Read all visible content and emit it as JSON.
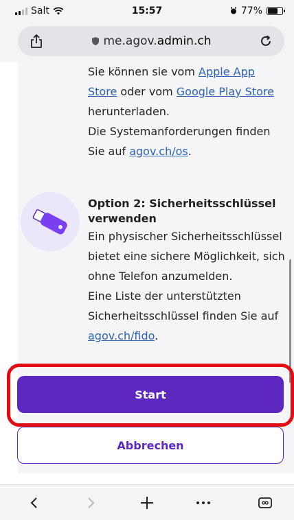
{
  "status": {
    "carrier": "Salt",
    "time": "15:57",
    "battery": "77%",
    "battery_level": 0.77
  },
  "browser": {
    "url_domain_prefix": "me.agov.",
    "url_domain_main": "admin.ch"
  },
  "content": {
    "block1": {
      "line1": "Sie können sie vom ",
      "link_apple": "Apple App Store",
      "line2": " oder vom ",
      "link_google": "Google Play Store",
      "line3": " herunterladen.",
      "line4": "Die Systemanforderungen finden Sie auf ",
      "link_os": "agov.ch/os",
      "line4_end": "."
    },
    "option2": {
      "title": "Option 2: Sicherheitsschlüssel verwenden",
      "text1": "Ein physischer Sicherheitsschlüssel bietet eine sichere Möglichkeit, sich ohne Telefon anzumelden.",
      "text2": "Eine Liste der unterstützten Sicherheitsschlüssel finden Sie auf ",
      "link_fido": "agov.ch/fido",
      "text2_end": "."
    }
  },
  "buttons": {
    "start": "Start",
    "cancel": "Abbrechen"
  },
  "colors": {
    "primary": "#5b27bf",
    "highlight": "#e10d12",
    "link": "#2d63b8"
  }
}
